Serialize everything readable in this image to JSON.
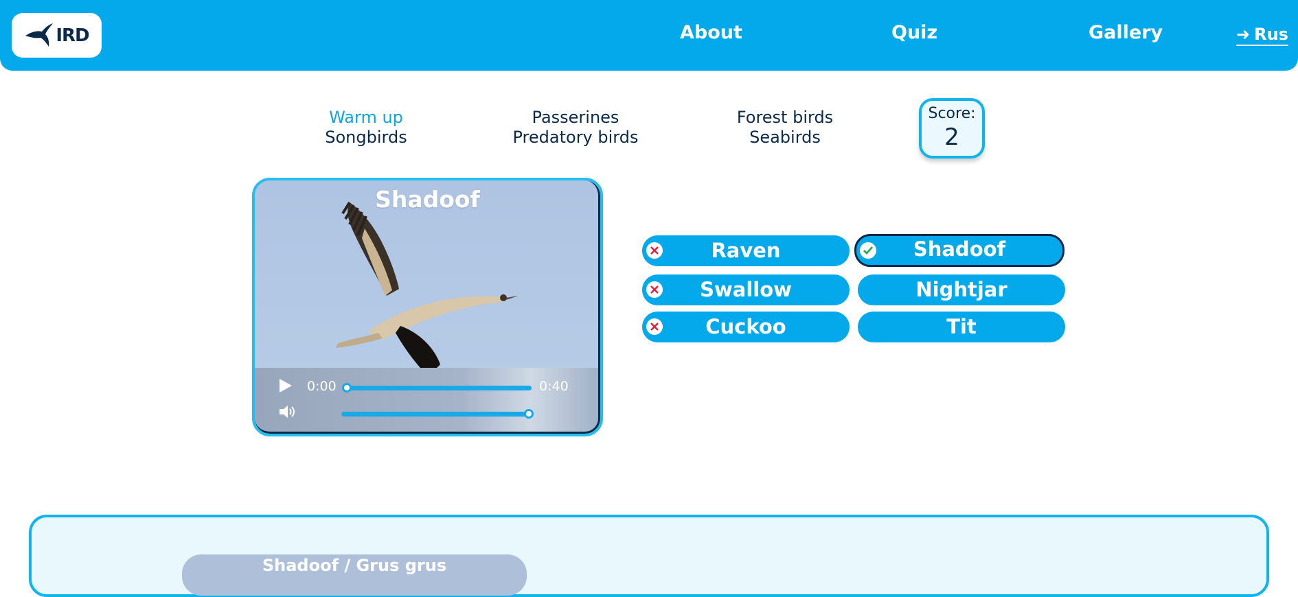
{
  "header": {
    "logo_text": "IRD",
    "nav": {
      "about": "About",
      "quiz": "Quiz",
      "gallery": "Gallery"
    },
    "lang_arrow": "➜",
    "lang_label": "Rus"
  },
  "categories": [
    {
      "top": "Warm up",
      "bottom": "Songbirds"
    },
    {
      "top": "Passerines",
      "bottom": "Predatory birds"
    },
    {
      "top": "Forest birds",
      "bottom": "Seabirds"
    }
  ],
  "score": {
    "label": "Score:",
    "value": "2"
  },
  "media": {
    "title": "Shadoof",
    "time_current": "0:00",
    "time_total": "0:40",
    "progress": 0.0,
    "volume": 1.0
  },
  "answers": [
    {
      "label": "Raven",
      "status": "wrong"
    },
    {
      "label": "Shadoof",
      "status": "correct"
    },
    {
      "label": "Swallow",
      "status": "wrong"
    },
    {
      "label": "Nightjar",
      "status": "none"
    },
    {
      "label": "Cuckoo",
      "status": "wrong"
    },
    {
      "label": "Tit",
      "status": "none"
    }
  ],
  "info_panel": {
    "title": "Shadoof / Grus grus"
  },
  "colors": {
    "brand": "#03a9ea",
    "dark": "#0b2a4a",
    "active_tab": "#0ea4e4",
    "wrong": "#e0203c",
    "correct": "#2ea84a"
  },
  "icons": {
    "logo": "swallow-icon",
    "play": "play-icon",
    "volume": "volume-icon",
    "wrong": "cross-icon",
    "correct": "check-icon"
  }
}
